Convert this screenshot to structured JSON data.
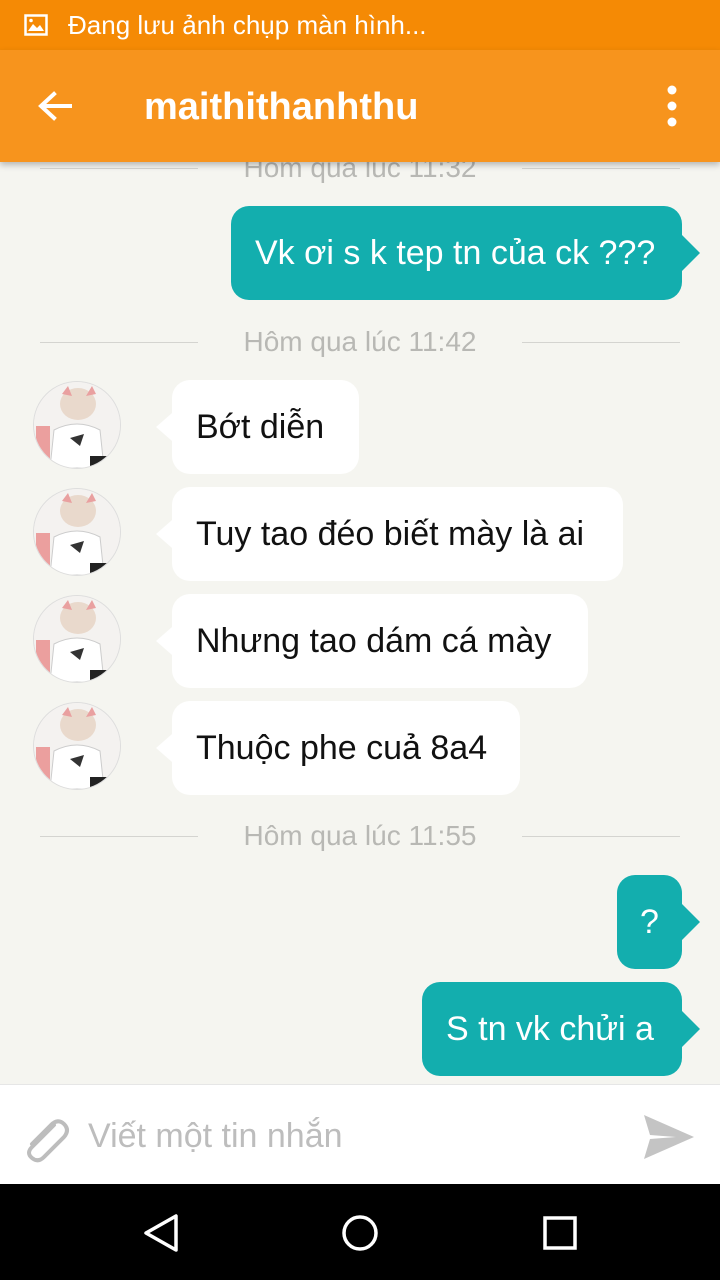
{
  "status_bar": {
    "icon": "image-icon",
    "text": "Đang lưu ảnh chụp màn hình..."
  },
  "header": {
    "title": "maithithanhthu",
    "back_icon": "arrow-left-icon",
    "menu_icon": "more-vert-icon"
  },
  "chat": {
    "dividers": [
      "Hôm qua lúc 11:32",
      "Hôm qua lúc 11:42",
      "Hôm qua lúc 11:55"
    ],
    "messages": [
      {
        "direction": "out",
        "text": "Vk ơi s k tep tn của ck ???"
      },
      {
        "direction": "in",
        "text": "Bớt diễn"
      },
      {
        "direction": "in",
        "text": "Tuy tao đéo biết mày là ai"
      },
      {
        "direction": "in",
        "text": "Nhưng tao dám cá mày"
      },
      {
        "direction": "in",
        "text": "Thuộc phe cuả 8a4"
      },
      {
        "direction": "out",
        "text": "?"
      },
      {
        "direction": "out",
        "text": "S tn vk chửi a"
      }
    ]
  },
  "composer": {
    "placeholder": "Viết một tin nhắn",
    "attach_icon": "paperclip-icon",
    "send_icon": "send-icon"
  },
  "nav": {
    "back_icon": "nav-back-icon",
    "home_icon": "nav-home-icon",
    "recents_icon": "nav-recents-icon"
  },
  "colors": {
    "status_bar": "#f58a05",
    "app_bar": "#f7941d",
    "outgoing_bubble": "#13aeae",
    "background": "#f5f5f0"
  }
}
